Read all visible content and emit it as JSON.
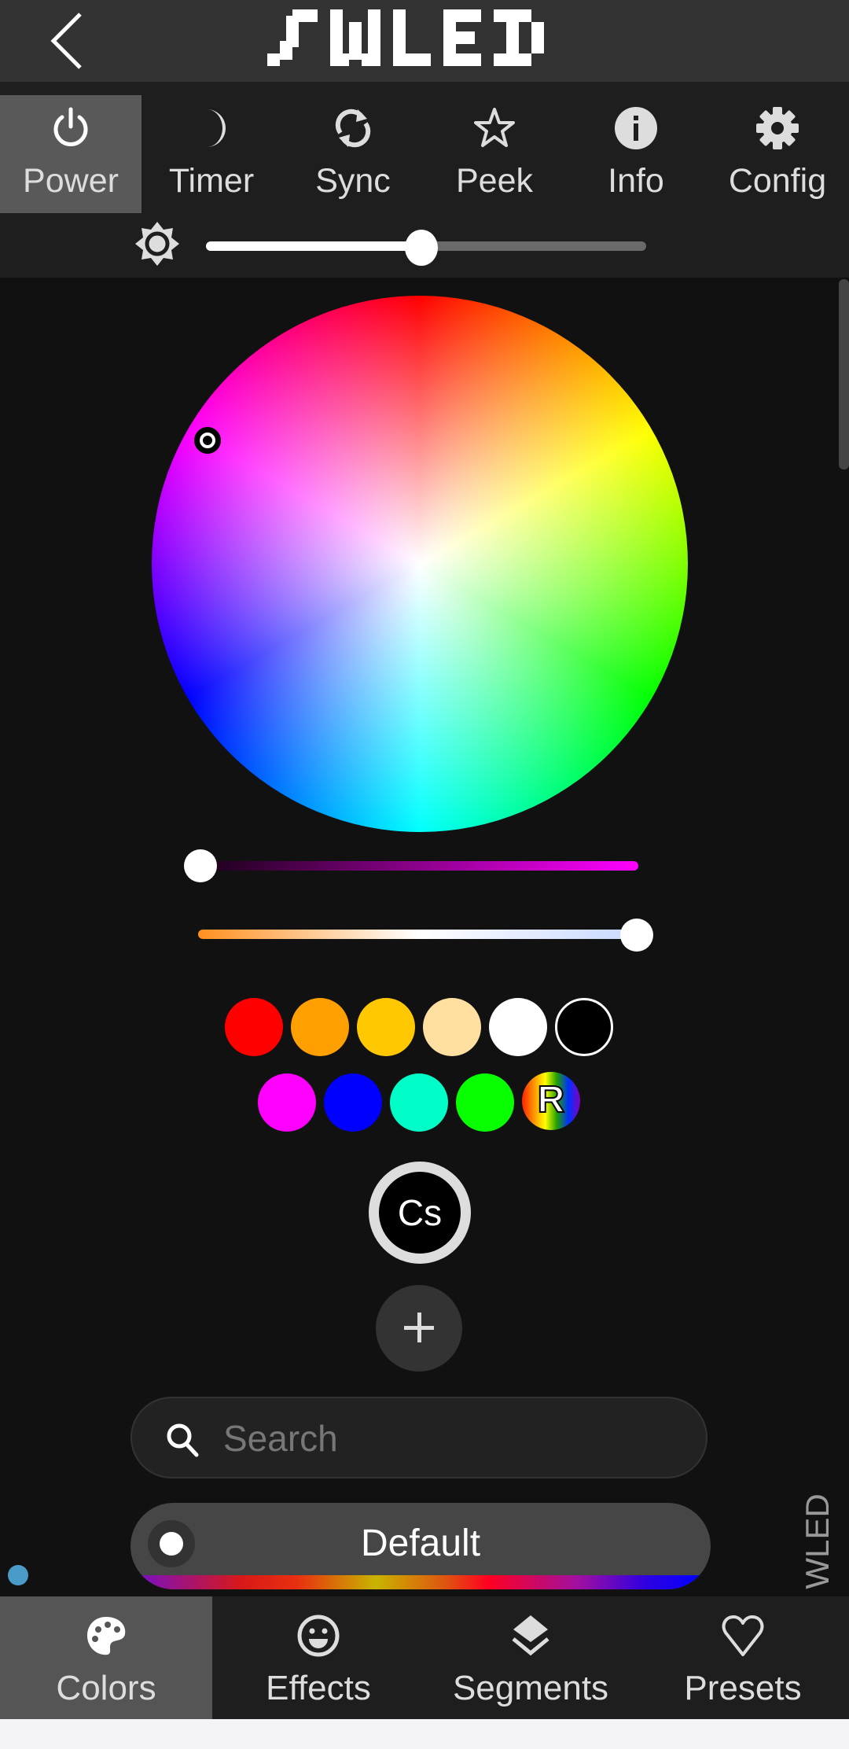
{
  "header": {
    "title": "WLED",
    "back_icon": "chevron-left-icon"
  },
  "top_tabs": [
    {
      "label": "Power",
      "icon": "power-icon",
      "active": true
    },
    {
      "label": "Timer",
      "icon": "moon-icon",
      "active": false
    },
    {
      "label": "Sync",
      "icon": "sync-icon",
      "active": false
    },
    {
      "label": "Peek",
      "icon": "star-icon",
      "active": false
    },
    {
      "label": "Info",
      "icon": "info-icon",
      "active": false
    },
    {
      "label": "Config",
      "icon": "gear-icon",
      "active": false
    }
  ],
  "brightness": {
    "icon": "brightness-icon",
    "value_fraction": 0.49
  },
  "color_picker": {
    "selected_color": "#ff33ff",
    "value_slider_fraction": 0.0,
    "cct_slider_fraction": 1.0
  },
  "swatches": {
    "row1": [
      "#ff0000",
      "#ffa000",
      "#ffc800",
      "#ffe0a0",
      "#ffffff",
      "#000000"
    ],
    "row2": [
      "#ff00ff",
      "#0000ff",
      "#00ffc8",
      "#08ff00"
    ],
    "random_label": "R"
  },
  "cs_button": {
    "label": "Cs"
  },
  "add_button": {
    "label": "+"
  },
  "search": {
    "placeholder": "Search",
    "value": ""
  },
  "palette": {
    "selected": "Default"
  },
  "side_label": "WLED",
  "bottom_nav": [
    {
      "label": "Colors",
      "icon": "palette-icon",
      "active": true
    },
    {
      "label": "Effects",
      "icon": "smiley-icon",
      "active": false
    },
    {
      "label": "Segments",
      "icon": "layers-icon",
      "active": false
    },
    {
      "label": "Presets",
      "icon": "heart-icon",
      "active": false
    }
  ],
  "colors": {
    "header_bg": "#333333",
    "tabs_bg": "#1e1e1e",
    "content_bg": "#111111",
    "active_tab": "#595959",
    "status_dot": "#4a9bc8"
  }
}
